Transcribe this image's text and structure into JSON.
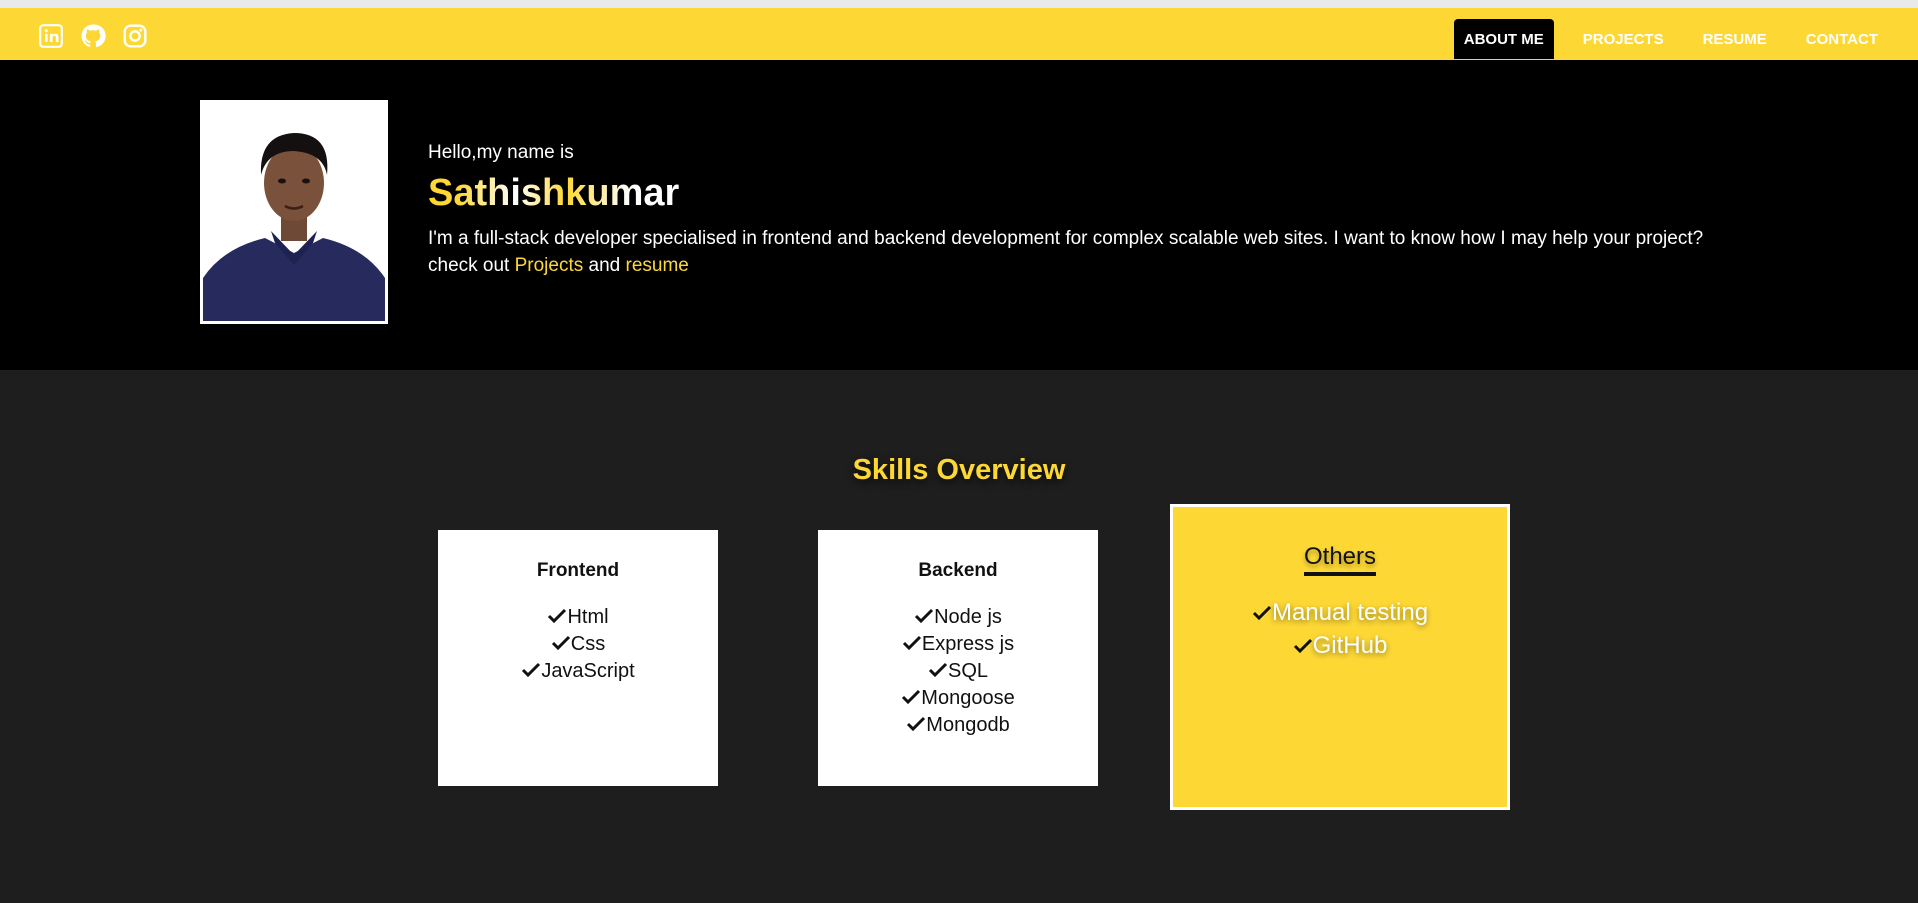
{
  "nav": {
    "social": [
      {
        "icon": "linkedin-icon"
      },
      {
        "icon": "github-icon"
      },
      {
        "icon": "instagram-icon"
      }
    ],
    "links": [
      {
        "label": "ABOUT ME",
        "active": true
      },
      {
        "label": "PROJECTS"
      },
      {
        "label": "RESUME"
      },
      {
        "label": "CONTACT"
      }
    ]
  },
  "hero": {
    "greeting": "Hello,my name is",
    "name": "Sathishkumar",
    "bio_text": "I'm a full-stack developer specialised in frontend and backend development for complex scalable web sites. I want to know how I may help your project? check out ",
    "bio_link_projects": "Projects",
    "bio_and": " and ",
    "bio_link_resume": "resume"
  },
  "skills": {
    "title": "Skills Overview",
    "frontend": {
      "title": "Frontend",
      "items": [
        "Html",
        "Css",
        "JavaScript"
      ]
    },
    "backend": {
      "title": "Backend",
      "items": [
        "Node js",
        "Express js",
        "SQL",
        "Mongoose",
        "Mongodb"
      ]
    },
    "others": {
      "title": "Others",
      "items": [
        "Manual testing",
        "GitHub"
      ]
    }
  },
  "colors": {
    "accent": "#fdd835",
    "hero_bg": "#000000",
    "page_bg": "#1e1e1e"
  }
}
